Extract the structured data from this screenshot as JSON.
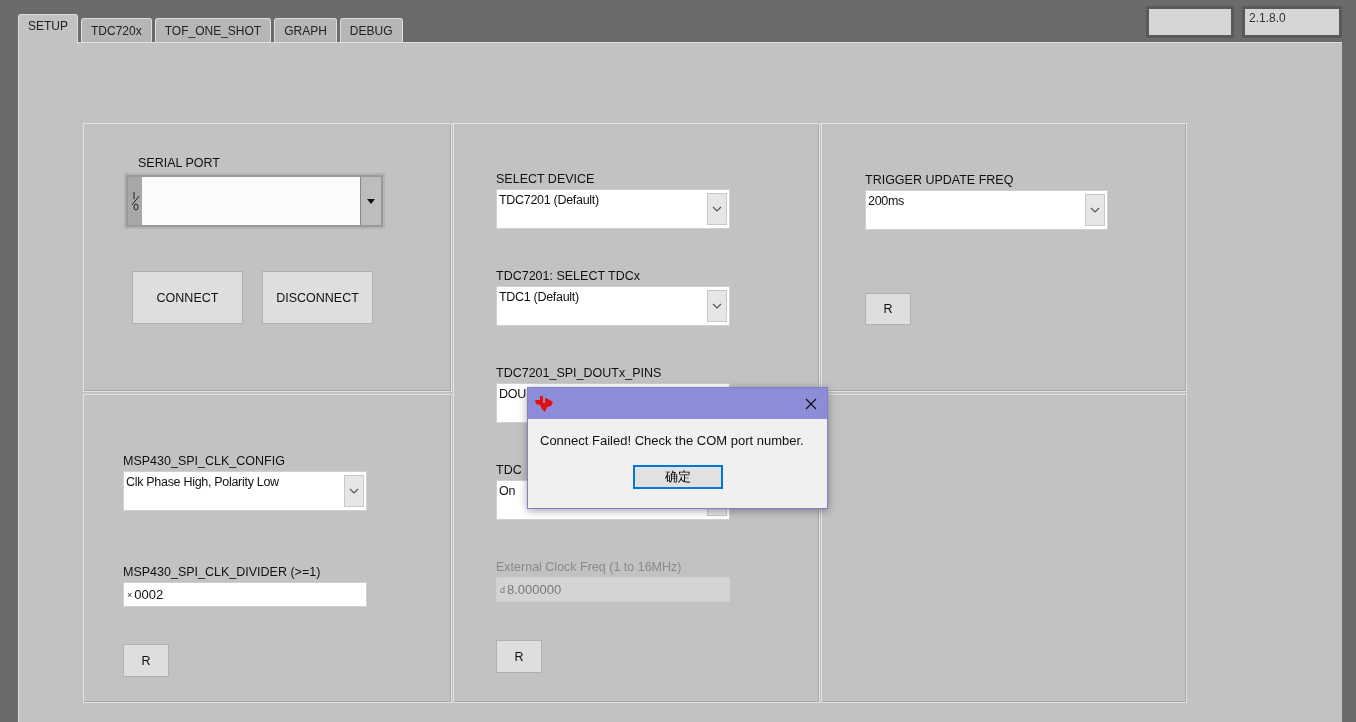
{
  "tabs": [
    {
      "label": "SETUP",
      "selected": true
    },
    {
      "label": "TDC720x",
      "selected": false
    },
    {
      "label": "TOF_ONE_SHOT",
      "selected": false
    },
    {
      "label": "GRAPH",
      "selected": false
    },
    {
      "label": "DEBUG",
      "selected": false
    }
  ],
  "version": "2.1.8.0",
  "serial_port": {
    "label": "SERIAL PORT",
    "buttons": [
      "CONNECT",
      "DISCONNECT"
    ]
  },
  "spi_clock": {
    "controls": [
      {
        "kind": "dropdown",
        "label": "MSP430_SPI_CLK_CONFIG",
        "value": "Clk Phase High, Polarity Low",
        "disabled": false
      },
      {
        "kind": "numeric",
        "label": "MSP430_SPI_CLK_DIVIDER (>=1)",
        "prefix": "×",
        "value": "0002",
        "disabled": false
      }
    ],
    "reset": "R"
  },
  "device": {
    "controls": [
      {
        "kind": "dropdown",
        "label": "SELECT DEVICE",
        "value": "TDC7201 (Default)",
        "disabled": false
      },
      {
        "kind": "dropdown",
        "label": "TDC7201: SELECT TDCx",
        "value": "TDC1 (Default)",
        "disabled": false
      },
      {
        "kind": "dropdown",
        "label": "TDC7201_SPI_DOUTx_PINS",
        "value": "DOU",
        "disabled": false
      },
      {
        "kind": "dropdown",
        "label": "TDC",
        "value": "On",
        "disabled": false
      },
      {
        "kind": "numeric",
        "label": "External Clock Freq (1 to 16MHz)",
        "prefix": "d",
        "value": "8.000000",
        "disabled": true
      }
    ],
    "reset": "R"
  },
  "trigger": {
    "controls": [
      {
        "kind": "dropdown",
        "label": "TRIGGER UPDATE FREQ",
        "value": "200ms",
        "disabled": false
      }
    ],
    "reset": "R"
  },
  "dialog": {
    "message": "Connect Failed! Check the COM port number.",
    "button": "确定"
  }
}
